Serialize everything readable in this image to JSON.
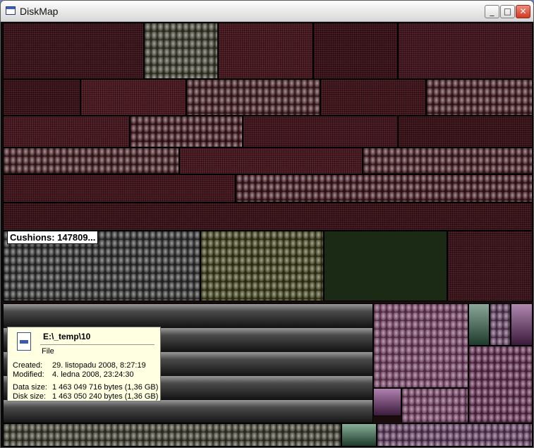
{
  "window": {
    "title": "DiskMap"
  },
  "controls": {
    "minimize": "_",
    "maximize": "□",
    "close": "✕"
  },
  "overlay_label": "Cushions: 147809...",
  "tooltip": {
    "path": "E:\\_temp\\10",
    "type": "File",
    "created_label": "Created:",
    "created_value": "29. listopadu 2008, 8:27:19",
    "modified_label": "Modified:",
    "modified_value": "4. ledna 2008, 23:24:30",
    "data_size_label": "Data size:",
    "data_size_value": "1 463 049 716 bytes (1,36 GB)",
    "disk_size_label": "Disk size:",
    "disk_size_value": "1 463 050 240 bytes (1,36 GB)"
  },
  "colors": {
    "maroon": "#4a1820",
    "dark_red": "#2d0e13",
    "olive": "#3a3a18",
    "gray": "#4a4a4a",
    "green": "#1a2a14",
    "mauve": "#6a3a5a",
    "teal": "#3a6a55",
    "tooltip_bg": "#ffffe1"
  }
}
